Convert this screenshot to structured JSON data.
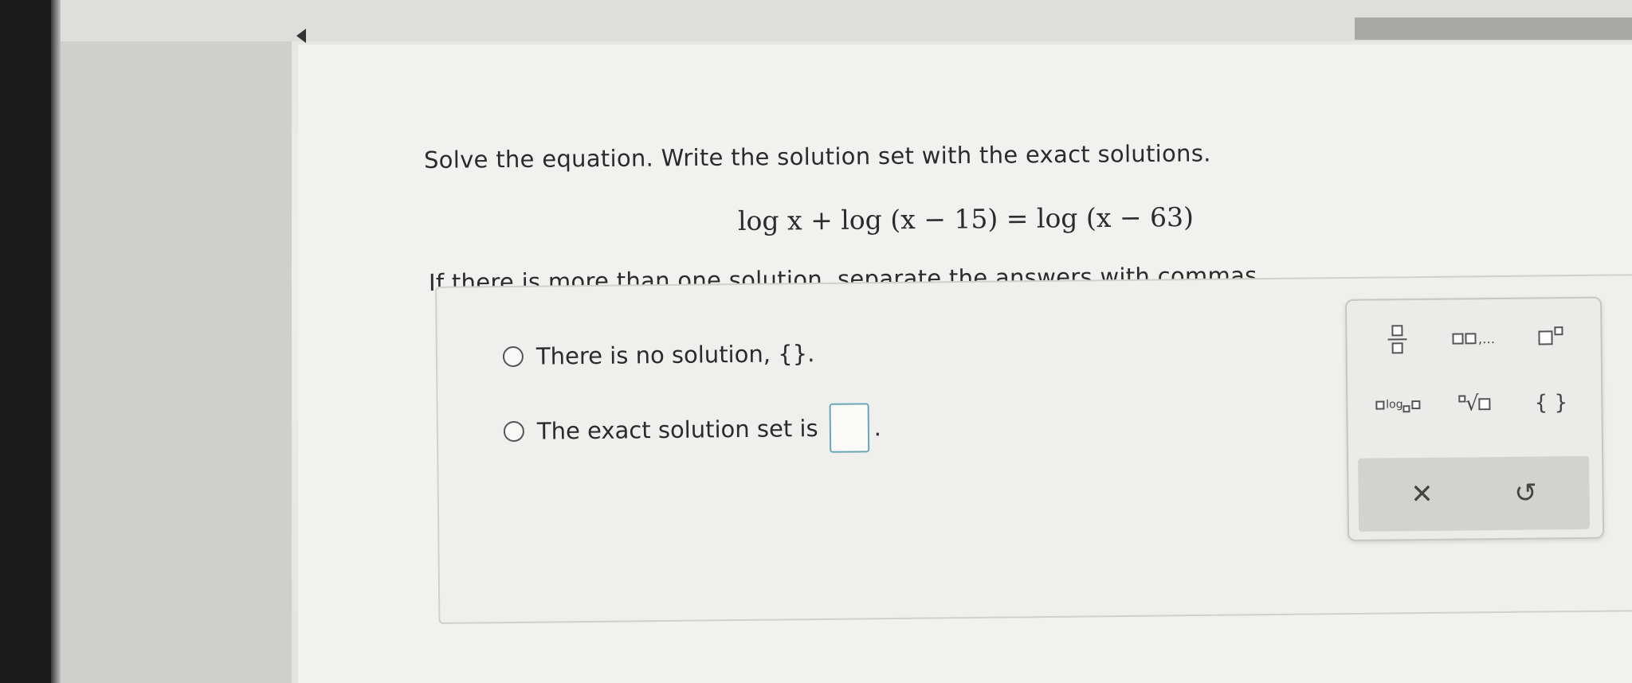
{
  "question": {
    "prompt": "Solve the equation. Write the solution set with the exact solutions.",
    "equation": "log x + log (x − 15) = log (x − 63)",
    "instruction": "If there is more than one solution, separate the answers with commas."
  },
  "answer": {
    "option_no_solution": "There is no solution, {}.",
    "option_solution_set": "The exact solution set is",
    "solution_set_period": ".",
    "solution_set_value": ""
  },
  "palette": {
    "icons": [
      "fraction-icon",
      "list-icon",
      "power-icon",
      "log-base-icon",
      "nth-root-icon",
      "braces-icon",
      "clear-icon",
      "undo-icon"
    ],
    "log_label": "log",
    "braces_label": "{ }",
    "clear_label": "✕",
    "undo_label": "↺"
  },
  "colors": {
    "answer_box_border": "#6aa7b4"
  }
}
